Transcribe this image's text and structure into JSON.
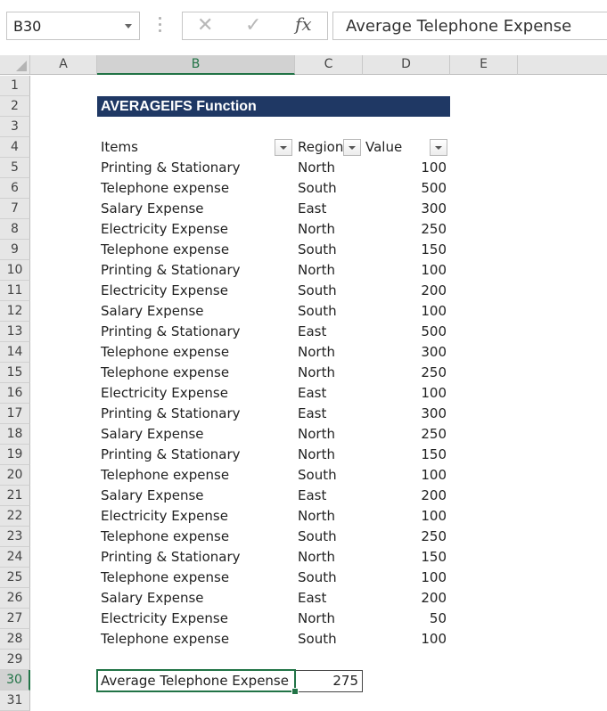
{
  "formula_bar": {
    "name_box": "B30",
    "formula": "Average Telephone Expense",
    "fx_label": "fx"
  },
  "columns": [
    "A",
    "B",
    "C",
    "D",
    "E"
  ],
  "rows": [
    "1",
    "2",
    "3",
    "4",
    "5",
    "6",
    "7",
    "8",
    "9",
    "10",
    "11",
    "12",
    "13",
    "14",
    "15",
    "16",
    "17",
    "18",
    "19",
    "20",
    "21",
    "22",
    "23",
    "24",
    "25",
    "26",
    "27",
    "28",
    "29",
    "30",
    "31"
  ],
  "sheet": {
    "title": "AVERAGEIFS Function",
    "headers": {
      "items": "Items",
      "region": "Region",
      "value": "Value"
    },
    "table": [
      {
        "item": "Printing & Stationary",
        "region": "North",
        "value": "100"
      },
      {
        "item": "Telephone expense",
        "region": "South",
        "value": "500"
      },
      {
        "item": "Salary Expense",
        "region": "East",
        "value": "300"
      },
      {
        "item": "Electricity Expense",
        "region": "North",
        "value": "250"
      },
      {
        "item": "Telephone expense",
        "region": "South",
        "value": "150"
      },
      {
        "item": "Printing & Stationary",
        "region": "North",
        "value": "100"
      },
      {
        "item": "Electricity Expense",
        "region": "South",
        "value": "200"
      },
      {
        "item": "Salary Expense",
        "region": "South",
        "value": "100"
      },
      {
        "item": "Printing & Stationary",
        "region": "East",
        "value": "500"
      },
      {
        "item": "Telephone expense",
        "region": "North",
        "value": "300"
      },
      {
        "item": "Telephone expense",
        "region": "North",
        "value": "250"
      },
      {
        "item": "Electricity Expense",
        "region": "East",
        "value": "100"
      },
      {
        "item": "Printing & Stationary",
        "region": "East",
        "value": "300"
      },
      {
        "item": "Salary Expense",
        "region": "North",
        "value": "250"
      },
      {
        "item": "Printing & Stationary",
        "region": "North",
        "value": "150"
      },
      {
        "item": "Telephone expense",
        "region": "South",
        "value": "100"
      },
      {
        "item": "Salary Expense",
        "region": "East",
        "value": "200"
      },
      {
        "item": "Electricity Expense",
        "region": "North",
        "value": "100"
      },
      {
        "item": "Telephone expense",
        "region": "South",
        "value": "250"
      },
      {
        "item": "Printing & Stationary",
        "region": "North",
        "value": "150"
      },
      {
        "item": "Telephone expense",
        "region": "South",
        "value": "100"
      },
      {
        "item": "Salary Expense",
        "region": "East",
        "value": "200"
      },
      {
        "item": "Electricity Expense",
        "region": "North",
        "value": "50"
      },
      {
        "item": "Telephone expense",
        "region": "South",
        "value": "100"
      }
    ],
    "result_label": "Average Telephone Expense",
    "result_value": "275"
  },
  "colors": {
    "title_bg": "#1f3864",
    "selection": "#217346"
  }
}
